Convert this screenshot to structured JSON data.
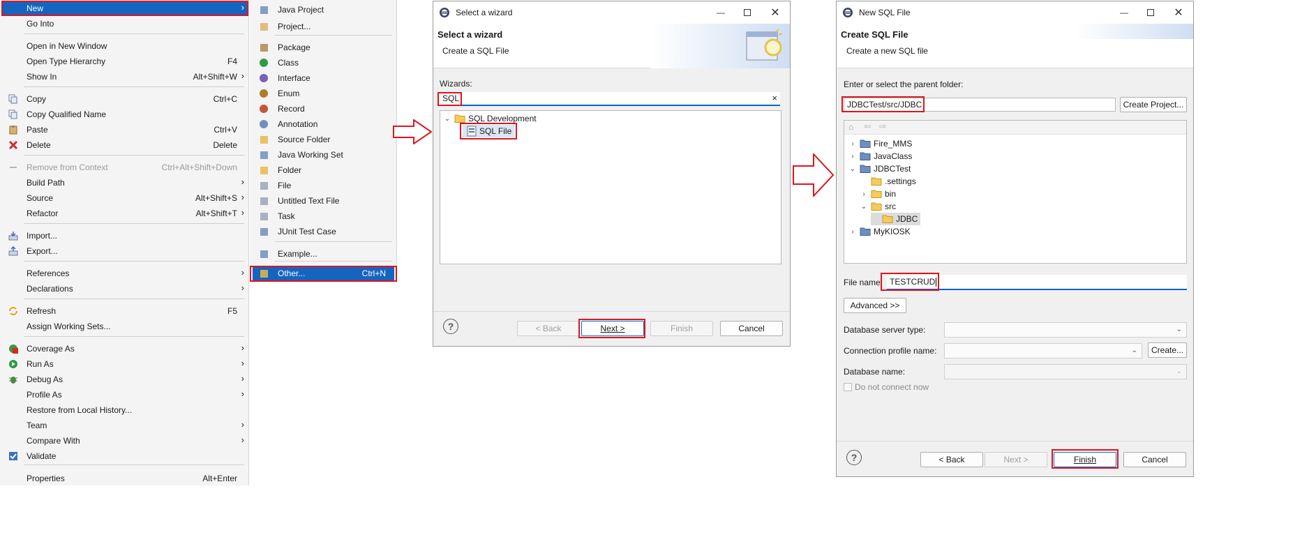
{
  "context_menu": {
    "items": [
      {
        "label": "New",
        "shortcut": "",
        "submenu": true,
        "icon": "",
        "selected": true,
        "disabled": false
      },
      {
        "label": "Go Into",
        "shortcut": "",
        "submenu": false,
        "icon": ""
      },
      {
        "label": "Open in New Window",
        "shortcut": "",
        "submenu": false,
        "icon": ""
      },
      {
        "label": "Open Type Hierarchy",
        "shortcut": "F4",
        "submenu": false,
        "icon": ""
      },
      {
        "label": "Show In",
        "shortcut": "Alt+Shift+W",
        "submenu": true,
        "icon": ""
      },
      {
        "label": "Copy",
        "shortcut": "Ctrl+C",
        "submenu": false,
        "icon": "copy-icon"
      },
      {
        "label": "Copy Qualified Name",
        "shortcut": "",
        "submenu": false,
        "icon": "copy-qualified-icon"
      },
      {
        "label": "Paste",
        "shortcut": "Ctrl+V",
        "submenu": false,
        "icon": "paste-icon"
      },
      {
        "label": "Delete",
        "shortcut": "Delete",
        "submenu": false,
        "icon": "delete-icon"
      },
      {
        "label": "Remove from Context",
        "shortcut": "Ctrl+Alt+Shift+Down",
        "submenu": false,
        "icon": "remove-context-icon",
        "disabled": true
      },
      {
        "label": "Build Path",
        "shortcut": "",
        "submenu": true,
        "icon": ""
      },
      {
        "label": "Source",
        "shortcut": "Alt+Shift+S",
        "submenu": true,
        "icon": ""
      },
      {
        "label": "Refactor",
        "shortcut": "Alt+Shift+T",
        "submenu": true,
        "icon": ""
      },
      {
        "label": "Import...",
        "shortcut": "",
        "submenu": false,
        "icon": "import-icon"
      },
      {
        "label": "Export...",
        "shortcut": "",
        "submenu": false,
        "icon": "export-icon"
      },
      {
        "label": "References",
        "shortcut": "",
        "submenu": true,
        "icon": ""
      },
      {
        "label": "Declarations",
        "shortcut": "",
        "submenu": true,
        "icon": ""
      },
      {
        "label": "Refresh",
        "shortcut": "F5",
        "submenu": false,
        "icon": "refresh-icon"
      },
      {
        "label": "Assign Working Sets...",
        "shortcut": "",
        "submenu": false,
        "icon": ""
      },
      {
        "label": "Coverage As",
        "shortcut": "",
        "submenu": true,
        "icon": "coverage-icon"
      },
      {
        "label": "Run As",
        "shortcut": "",
        "submenu": true,
        "icon": "run-icon"
      },
      {
        "label": "Debug As",
        "shortcut": "",
        "submenu": true,
        "icon": "debug-icon"
      },
      {
        "label": "Profile As",
        "shortcut": "",
        "submenu": true,
        "icon": ""
      },
      {
        "label": "Restore from Local History...",
        "shortcut": "",
        "submenu": false,
        "icon": ""
      },
      {
        "label": "Team",
        "shortcut": "",
        "submenu": true,
        "icon": ""
      },
      {
        "label": "Compare With",
        "shortcut": "",
        "submenu": true,
        "icon": ""
      },
      {
        "label": "Validate",
        "shortcut": "",
        "submenu": false,
        "icon": "checkmark-icon"
      },
      {
        "label": "Properties",
        "shortcut": "Alt+Enter",
        "submenu": false,
        "icon": ""
      }
    ]
  },
  "new_submenu": {
    "items": [
      {
        "label": "Java Project",
        "shortcut": "",
        "icon": "java-project-icon"
      },
      {
        "label": "Project...",
        "shortcut": "",
        "icon": "project-icon"
      },
      {
        "label": "Package",
        "shortcut": "",
        "icon": "package-icon"
      },
      {
        "label": "Class",
        "shortcut": "",
        "icon": "class-icon"
      },
      {
        "label": "Interface",
        "shortcut": "",
        "icon": "interface-icon"
      },
      {
        "label": "Enum",
        "shortcut": "",
        "icon": "enum-icon"
      },
      {
        "label": "Record",
        "shortcut": "",
        "icon": "record-icon"
      },
      {
        "label": "Annotation",
        "shortcut": "",
        "icon": "annotation-icon"
      },
      {
        "label": "Source Folder",
        "shortcut": "",
        "icon": "source-folder-icon"
      },
      {
        "label": "Java Working Set",
        "shortcut": "",
        "icon": "working-set-icon"
      },
      {
        "label": "Folder",
        "shortcut": "",
        "icon": "folder-icon"
      },
      {
        "label": "File",
        "shortcut": "",
        "icon": "file-icon"
      },
      {
        "label": "Untitled Text File",
        "shortcut": "",
        "icon": "text-file-icon"
      },
      {
        "label": "Task",
        "shortcut": "",
        "icon": "task-icon"
      },
      {
        "label": "JUnit Test Case",
        "shortcut": "",
        "icon": "junit-icon"
      },
      {
        "label": "Example...",
        "shortcut": "",
        "icon": "example-icon"
      },
      {
        "label": "Other...",
        "shortcut": "Ctrl+N",
        "icon": "other-icon"
      }
    ]
  },
  "wizard_dialog": {
    "title": "Select a wizard",
    "header_title": "Select a wizard",
    "header_subtitle": "Create a SQL File",
    "wizards_label": "Wizards:",
    "filter_value": "SQL",
    "clear_icon": "×",
    "tree": {
      "category": "SQL Development",
      "item": "SQL File"
    },
    "buttons": {
      "back": "< Back",
      "next": "Next >",
      "finish": "Finish",
      "cancel": "Cancel"
    }
  },
  "sql_dialog": {
    "title": "New SQL File",
    "header_title": "Create SQL File",
    "header_subtitle": "Create a new SQL file",
    "parent_label": "Enter or select the parent folder:",
    "parent_value": "JDBCTest/src/JDBC",
    "create_project": "Create Project...",
    "tree": [
      {
        "label": "Fire_MMS",
        "twisty": "›",
        "indent": 0,
        "type": "project"
      },
      {
        "label": "JavaClass",
        "twisty": "›",
        "indent": 0,
        "type": "project"
      },
      {
        "label": "JDBCTest",
        "twisty": "⌄",
        "indent": 0,
        "type": "project"
      },
      {
        "label": ".settings",
        "twisty": "",
        "indent": 1,
        "type": "folder"
      },
      {
        "label": "bin",
        "twisty": "›",
        "indent": 1,
        "type": "folder"
      },
      {
        "label": "src",
        "twisty": "⌄",
        "indent": 1,
        "type": "folder"
      },
      {
        "label": "JDBC",
        "twisty": "",
        "indent": 2,
        "type": "folder",
        "selected": true
      },
      {
        "label": "MyKIOSK",
        "twisty": "›",
        "indent": 0,
        "type": "project"
      }
    ],
    "file_name_label": "File name:",
    "file_name_value": "TESTCRUD",
    "advanced": "Advanced >>",
    "db_server_label": "Database server type:",
    "conn_profile_label": "Connection profile name:",
    "create_btn": "Create...",
    "db_name_label": "Database name:",
    "do_not_connect": "Do not connect now",
    "buttons": {
      "back": "< Back",
      "next": "Next >",
      "finish": "Finish",
      "cancel": "Cancel"
    }
  },
  "colors": {
    "highlight": "#1565c0",
    "annotation_red": "#e0141e",
    "focus_blue": "#0a64c2"
  }
}
